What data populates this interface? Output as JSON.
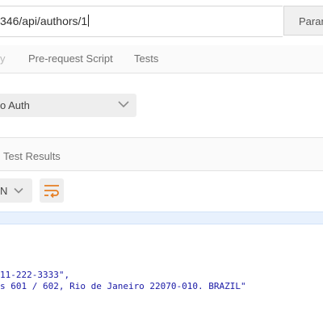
{
  "request": {
    "url": "346/api/authors/1",
    "params_label": "Paran"
  },
  "request_tabs": {
    "cut_tab": "y",
    "prerequest": "Pre-request Script",
    "tests": "Tests"
  },
  "auth": {
    "selected": "o Auth"
  },
  "response_tabs": {
    "test_results": "Test Results"
  },
  "response_toolbar": {
    "format": "N"
  },
  "response_body": {
    "line1": "11-222-3333\",",
    "line2": "s 601 / 602, Rio de Janeiro 22070-010. BRAZIL\""
  },
  "colors": {
    "code_string": "#1a1aa6",
    "wrap_icon": "#e67e22",
    "highlight_line": "#e8f1fd"
  },
  "icons": {
    "auth_dropdown": "chevron-down-icon",
    "format_dropdown": "chevron-down-icon",
    "wrap": "wrap-lines-icon"
  }
}
